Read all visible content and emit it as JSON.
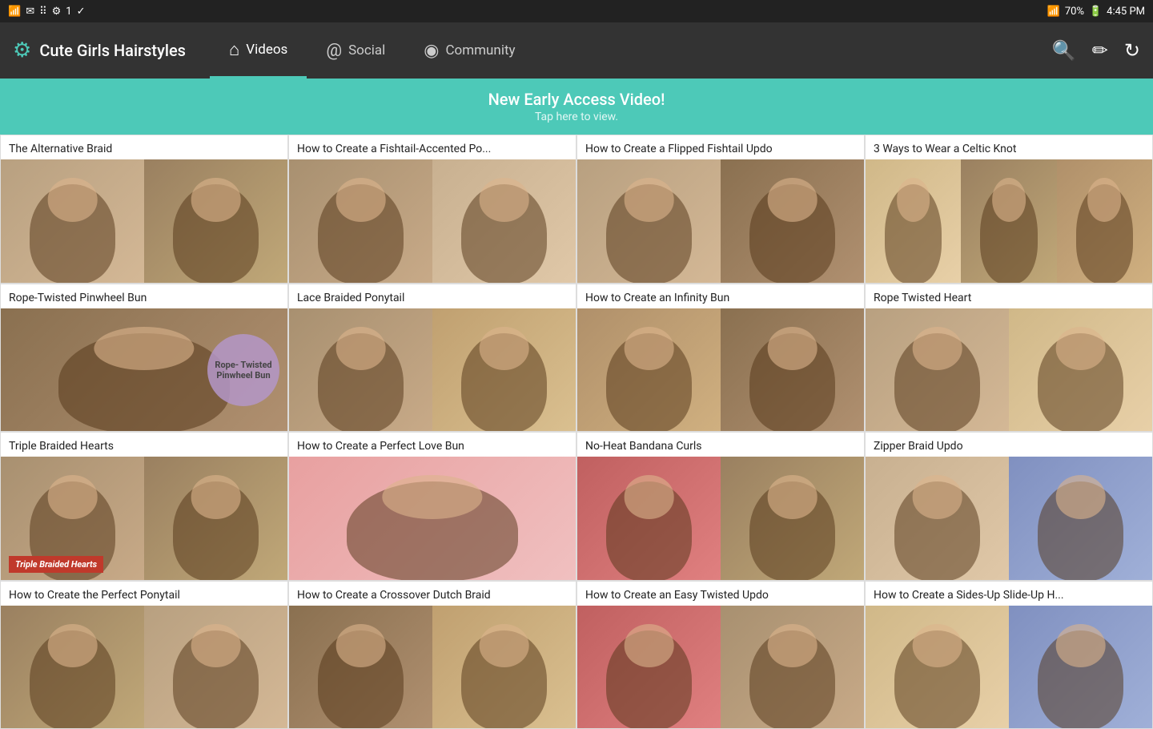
{
  "statusBar": {
    "time": "4:45 PM",
    "battery": "70%",
    "icons": [
      "message",
      "mail",
      "grid",
      "settings",
      "number",
      "check"
    ]
  },
  "nav": {
    "brand": "Cute Girls Hairstyles",
    "brandIconSymbol": "⚙",
    "tabs": [
      {
        "id": "videos",
        "label": "Videos",
        "icon": "🏠",
        "active": true
      },
      {
        "id": "social",
        "label": "Social",
        "icon": "◎"
      },
      {
        "id": "community",
        "label": "Community",
        "icon": "◉"
      }
    ],
    "actions": {
      "search": "🔍",
      "edit": "✏",
      "refresh": "↻"
    }
  },
  "banner": {
    "title": "New Early Access Video!",
    "subtitle": "Tap here to view."
  },
  "videos": [
    {
      "title": "The Alternative Braid",
      "images": [
        "p1",
        "p2"
      ],
      "overlay": null
    },
    {
      "title": "How to Create a Fishtail-Accented Po...",
      "images": [
        "p3",
        "p4"
      ],
      "overlay": null
    },
    {
      "title": "How to Create a Flipped Fishtail Updo",
      "images": [
        "p1",
        "p5"
      ],
      "overlay": null
    },
    {
      "title": "3 Ways to Wear a Celtic Knot",
      "images": [
        "p6",
        "p2",
        "p7"
      ],
      "overlay": null
    },
    {
      "title": "Rope-Twisted Pinwheel Bun",
      "images": [
        "p5"
      ],
      "overlay": "oval",
      "ovalText": "Rope-\nTwisted\nPinwheel\nBun"
    },
    {
      "title": "Lace Braided Ponytail",
      "images": [
        "p3",
        "p8"
      ],
      "overlay": null
    },
    {
      "title": "How to Create an Infinity Bun",
      "images": [
        "p7",
        "p5"
      ],
      "overlay": null
    },
    {
      "title": "Rope Twisted Heart",
      "images": [
        "p1",
        "p6"
      ],
      "overlay": null
    },
    {
      "title": "Triple Braided Hearts",
      "images": [
        "p3",
        "p2"
      ],
      "overlay": "text",
      "overlayText": "Triple Braided Hearts"
    },
    {
      "title": "How to Create a Perfect Love Bun",
      "images": [
        "ppink"
      ],
      "overlay": null
    },
    {
      "title": "No-Heat Bandana Curls",
      "images": [
        "pred",
        "p2"
      ],
      "overlay": null
    },
    {
      "title": "Zipper Braid Updo",
      "images": [
        "p4",
        "pblue"
      ],
      "overlay": null
    },
    {
      "title": "How to Create the Perfect Ponytail",
      "images": [
        "p2",
        "p1"
      ],
      "overlay": null
    },
    {
      "title": "How to Create a Crossover Dutch Braid",
      "images": [
        "p5",
        "p8"
      ],
      "overlay": null
    },
    {
      "title": "How to Create an Easy Twisted Updo",
      "images": [
        "pred",
        "p3"
      ],
      "overlay": null
    },
    {
      "title": "How to Create a Sides-Up Slide-Up H...",
      "images": [
        "p6",
        "pblue"
      ],
      "overlay": null
    }
  ],
  "colorMap": {
    "p1": [
      "#b8a080",
      "#d4b896"
    ],
    "p2": [
      "#9a8060",
      "#c0a878"
    ],
    "p3": [
      "#a89070",
      "#c8aa88"
    ],
    "p4": [
      "#c8b090",
      "#e0c8a8"
    ],
    "p5": [
      "#8a7050",
      "#b09070"
    ],
    "p6": [
      "#d0b888",
      "#e8d0a8"
    ],
    "p7": [
      "#b0906a",
      "#d0b080"
    ],
    "p8": [
      "#c0a070",
      "#dac090"
    ],
    "pgreen": [
      "#88b090",
      "#aacca8"
    ],
    "ppink": [
      "#e8a0a0",
      "#f0c0c0"
    ],
    "pred": [
      "#c06060",
      "#e08080"
    ],
    "pblue": [
      "#8090c0",
      "#a0b0d8"
    ],
    "ppurple": [
      "#9080b0",
      "#b0a0d0"
    ]
  }
}
